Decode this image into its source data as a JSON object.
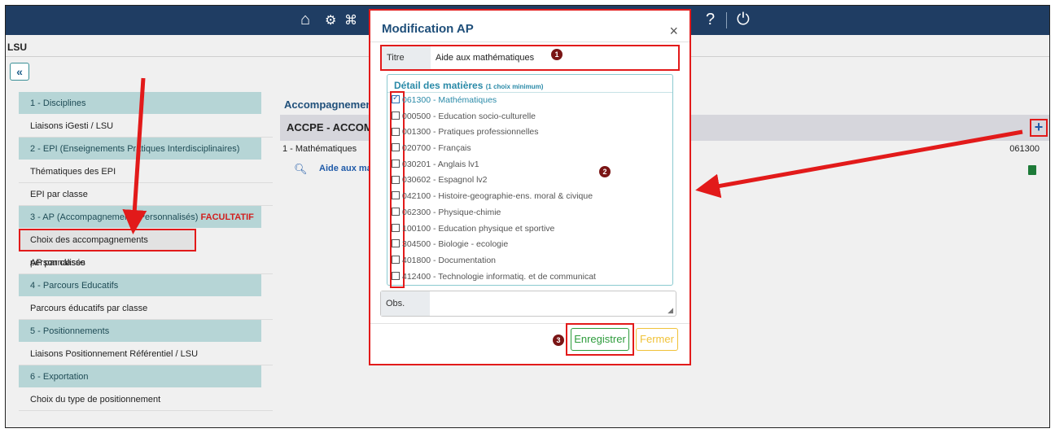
{
  "topbar": {
    "help": "?"
  },
  "header": {
    "title": "LSU",
    "collapse_icon": "«"
  },
  "sidebar": {
    "items": [
      {
        "label": "1 - Disciplines",
        "kind": "section"
      },
      {
        "label": "Liaisons iGesti / LSU",
        "kind": "item"
      },
      {
        "label": "2 - EPI (Enseignements Pratiques Interdisciplinaires)",
        "kind": "section"
      },
      {
        "label": "Thématiques des EPI",
        "kind": "item"
      },
      {
        "label": "EPI par classe",
        "kind": "item"
      },
      {
        "label": "3 - AP (Accompagnements Personnalisés)",
        "suffix": "FACULTATIF",
        "kind": "section"
      },
      {
        "label": "Choix des accompagnements personnalisés",
        "kind": "item",
        "selected": true
      },
      {
        "label": "AP par classe",
        "kind": "item"
      },
      {
        "label": "4 - Parcours Educatifs",
        "kind": "section"
      },
      {
        "label": "Parcours éducatifs par classe",
        "kind": "item"
      },
      {
        "label": "5 - Positionnements",
        "kind": "section"
      },
      {
        "label": "Liaisons Positionnement Référentiel / LSU",
        "kind": "item"
      },
      {
        "label": "6 - Exportation",
        "kind": "section"
      },
      {
        "label": "Choix du type de positionnement",
        "kind": "item"
      }
    ]
  },
  "main": {
    "heading": "Accompagnement",
    "bar_title": "ACCPE - ACCOMPA",
    "add_icon": "+",
    "row_label": "1 - Mathématiques",
    "row_code": "061300",
    "row_item": "Aide aux ma"
  },
  "modal": {
    "title": "Modification AP",
    "close_glyph": "×",
    "titre_label": "Titre",
    "titre_value": "Aide aux mathématiques",
    "detail_heading": "Détail des matières",
    "detail_hint": "(1 choix minimum)",
    "subjects": [
      {
        "label": "061300 - Mathématiques",
        "checked": true
      },
      {
        "label": "000500 - Education socio-culturelle",
        "checked": false
      },
      {
        "label": "001300 - Pratiques professionnelles",
        "checked": false
      },
      {
        "label": "020700 - Français",
        "checked": false
      },
      {
        "label": "030201 - Anglais lv1",
        "checked": false
      },
      {
        "label": "030602 - Espagnol lv2",
        "checked": false
      },
      {
        "label": "042100 - Histoire-geographie-ens. moral & civique",
        "checked": false
      },
      {
        "label": "062300 - Physique-chimie",
        "checked": false
      },
      {
        "label": "100100 - Education physique et sportive",
        "checked": false
      },
      {
        "label": "304500 - Biologie - ecologie",
        "checked": false
      },
      {
        "label": "401800 - Documentation",
        "checked": false
      },
      {
        "label": "412400 - Technologie informatiq. et de communicat",
        "checked": false
      }
    ],
    "obs_label": "Obs.",
    "save_label": "Enregistrer",
    "close_label": "Fermer",
    "badges": [
      "1",
      "2",
      "3"
    ]
  },
  "colors": {
    "annotation": "#e21a1a",
    "topbar": "#1f3d63",
    "section": "#b6d5d6",
    "save": "#2e9c3c",
    "close": "#f0c238"
  }
}
